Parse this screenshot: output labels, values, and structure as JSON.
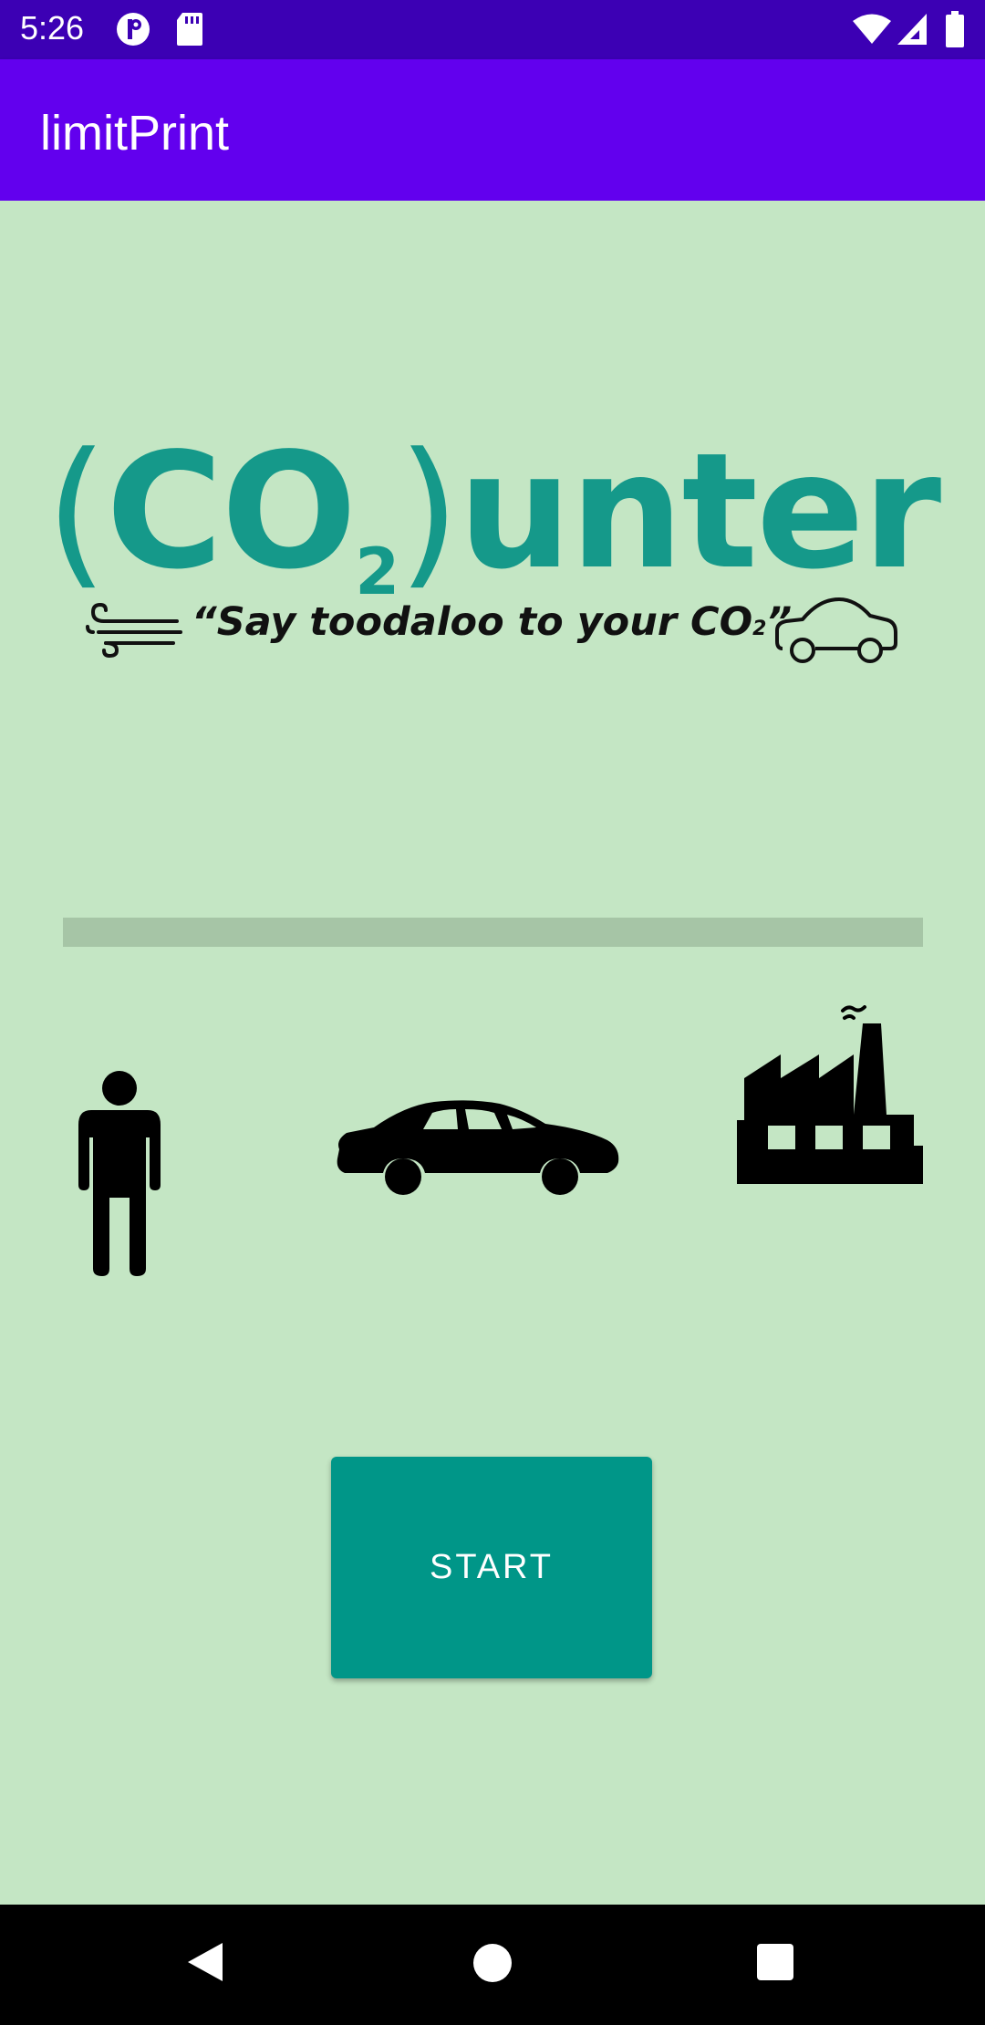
{
  "status_bar": {
    "time": "5:26",
    "icons": [
      "app-notification-icon",
      "sd-card-icon",
      "wifi-icon",
      "cell-signal-icon",
      "battery-icon"
    ]
  },
  "app_bar": {
    "title": "limitPrint"
  },
  "logo": {
    "open_paren": "(",
    "co": "CO",
    "sub": "2",
    "close_paren": ")",
    "rest": "unter",
    "color": "#15998a"
  },
  "slogan": {
    "text_start": "“Say toodaloo to your CO",
    "sub": "2",
    "text_end": "”",
    "icons": [
      "wind-icon",
      "car-outline-icon"
    ]
  },
  "progress": {
    "value": 0
  },
  "emitters": [
    "person-icon",
    "car-icon",
    "factory-icon"
  ],
  "start_button": {
    "label": "START"
  },
  "colors": {
    "status_bar": "#3c00b4",
    "app_bar": "#6200ee",
    "background": "#c4e6c4",
    "button": "#009688"
  },
  "nav_bar": {
    "icons": [
      "back-icon",
      "home-icon",
      "recents-icon"
    ]
  }
}
